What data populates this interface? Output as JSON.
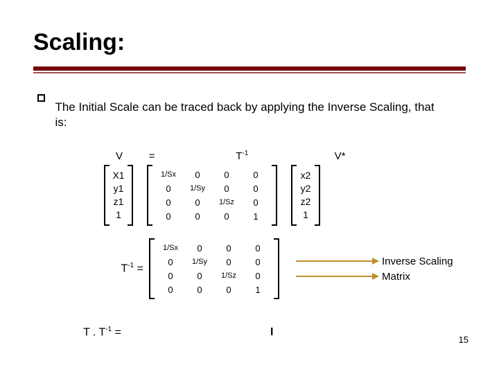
{
  "title": "Scaling:",
  "bullet": "The Initial Scale can be traced back by applying the Inverse Scaling, that is:",
  "headers": {
    "V": "V",
    "eq": "=",
    "Tinv": "T",
    "Tsup": "-1",
    "Vstar": "V*"
  },
  "vecV": [
    "X1",
    "y1",
    "z1",
    "1"
  ],
  "vecVs": [
    "x2",
    "y2",
    "z2",
    "1"
  ],
  "mat": {
    "r0": [
      "1/Sx",
      "0",
      "0",
      "0"
    ],
    "r1": [
      "0",
      "1/Sy",
      "0",
      "0"
    ],
    "r2": [
      "0",
      "0",
      "1/Sz",
      "0"
    ],
    "r3": [
      "0",
      "0",
      "0",
      "1"
    ]
  },
  "row2_label_T": "T",
  "row2_label_sup": "-1",
  "row2_label_eq": " =",
  "arrow1": "Inverse Scaling",
  "arrow2": "Matrix",
  "row3_lhs": "T . T",
  "row3_sup": "-1",
  "row3_eq": " =",
  "row3_rhs": "I",
  "page": "15"
}
